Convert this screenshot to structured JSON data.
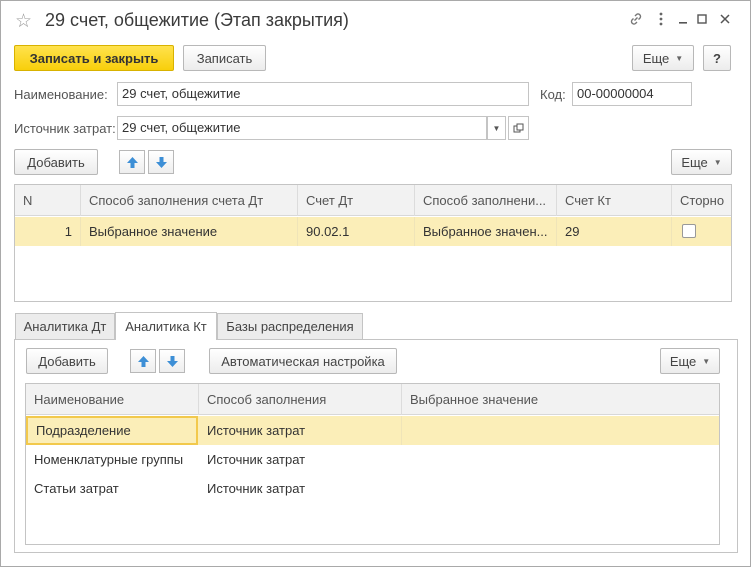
{
  "window": {
    "title": "29 счет, общежитие (Этап закрытия)",
    "icons": [
      "star-icon",
      "link-icon",
      "more-vertical-icon",
      "minimize-icon",
      "maximize-icon",
      "close-icon"
    ]
  },
  "toolbar": {
    "save_close_label": "Записать и закрыть",
    "save_label": "Записать",
    "more_label": "Еще",
    "help_label": "?"
  },
  "form": {
    "name_label": "Наименование:",
    "name_value": "29 счет, общежитие",
    "code_label": "Код:",
    "code_value": "00-00000004",
    "cost_source_label": "Источник затрат:",
    "cost_source_value": "29 счет, общежитие"
  },
  "table_toolbar": {
    "add_label": "Добавить",
    "more_label": "Еще"
  },
  "accounts_table": {
    "columns": [
      "N",
      "Способ заполнения счета Дт",
      "Счет Дт",
      "Способ заполнени...",
      "Счет Кт",
      "Сторно"
    ],
    "rows": [
      {
        "n": "1",
        "fill_method_dt": "Выбранное значение",
        "account_dt": "90.02.1",
        "fill_method_kt": "Выбранное значен...",
        "account_kt": "29",
        "storno": false
      }
    ]
  },
  "tabs": [
    {
      "label": "Аналитика Дт",
      "active": false
    },
    {
      "label": "Аналитика Кт",
      "active": true
    },
    {
      "label": "Базы распределения",
      "active": false
    }
  ],
  "tab_toolbar": {
    "add_label": "Добавить",
    "auto_setup_label": "Автоматическая настройка",
    "more_label": "Еще"
  },
  "analytics_table": {
    "columns": [
      "Наименование",
      "Способ заполнения",
      "Выбранное значение"
    ],
    "rows": [
      {
        "name": "Подразделение",
        "fill_method": "Источник затрат",
        "value": ""
      },
      {
        "name": "Номенклатурные группы",
        "fill_method": "Источник затрат",
        "value": ""
      },
      {
        "name": "Статьи затрат",
        "fill_method": "Источник затрат",
        "value": ""
      }
    ]
  },
  "colors": {
    "primary_button": "#f8cf0b",
    "selected_row": "#fbeeb8",
    "arrow_blue": "#3d8fd6"
  }
}
